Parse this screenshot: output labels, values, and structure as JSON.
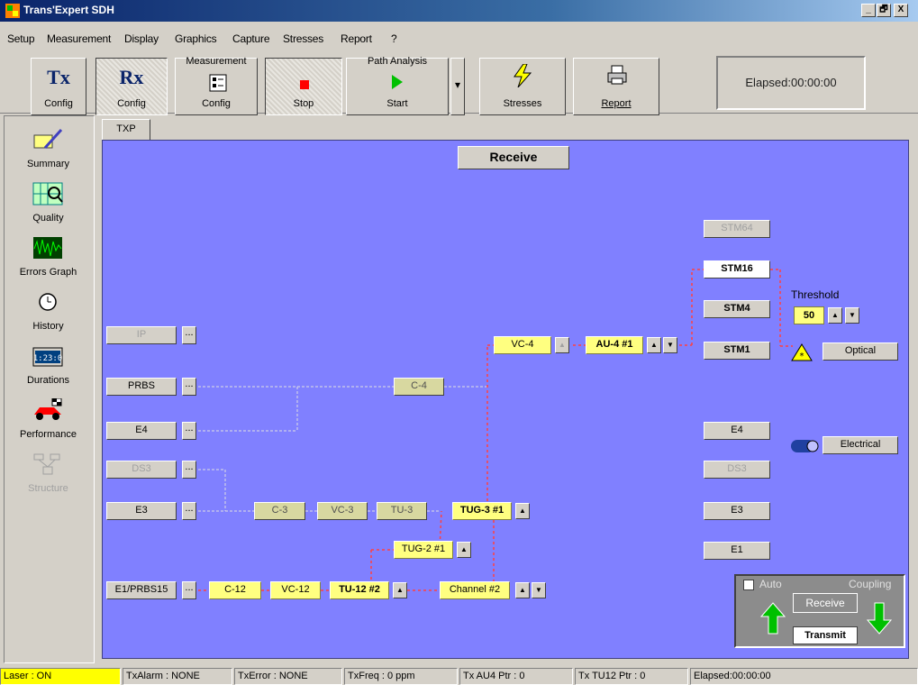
{
  "window": {
    "title": "Trans'Expert SDH",
    "min": "_",
    "max": "🗗",
    "close": "X"
  },
  "menu": [
    "Setup",
    "Measurement",
    "Display",
    "Graphics",
    "Capture",
    "Stresses",
    "Report",
    "?"
  ],
  "toolbar": {
    "tx": {
      "glyph": "Tx",
      "label": "Config"
    },
    "rx": {
      "glyph": "Rx",
      "label": "Config"
    },
    "measurement": {
      "top": "Measurement",
      "label": "Config"
    },
    "stop": {
      "label": "Stop"
    },
    "start": {
      "top": "Path Analysis",
      "label": "Start",
      "dropdown": "▾"
    },
    "stresses": {
      "label": "Stresses"
    },
    "report": {
      "label": "Report"
    },
    "elapsed": "Elapsed:00:00:00"
  },
  "sidebar": [
    {
      "name": "summary",
      "label": "Summary",
      "icon": "summary-icon",
      "enabled": true
    },
    {
      "name": "quality",
      "label": "Quality",
      "icon": "quality-icon",
      "enabled": true
    },
    {
      "name": "errors-graph",
      "label": "Errors Graph",
      "icon": "errors-graph-icon",
      "enabled": true
    },
    {
      "name": "history",
      "label": "History",
      "icon": "clock-icon",
      "enabled": true
    },
    {
      "name": "durations",
      "label": "Durations",
      "icon": "timer-icon",
      "enabled": true,
      "readout": "01:23:01"
    },
    {
      "name": "performance",
      "label": "Performance",
      "icon": "race-car-icon",
      "enabled": true
    },
    {
      "name": "structure",
      "label": "Structure",
      "icon": "structure-icon",
      "enabled": false
    }
  ],
  "tab": "TXP",
  "canvas": {
    "title": "Receive",
    "left_signals": [
      {
        "id": "ip",
        "label": "IP",
        "enabled": false
      },
      {
        "id": "prbs",
        "label": "PRBS",
        "enabled": true
      },
      {
        "id": "e4",
        "label": "E4",
        "enabled": true
      },
      {
        "id": "ds3",
        "label": "DS3",
        "enabled": false
      },
      {
        "id": "e3",
        "label": "E3",
        "enabled": true
      },
      {
        "id": "e1prbs",
        "label": "E1/PRBS15",
        "enabled": true
      }
    ],
    "ellipsis": "...",
    "c4": "C-4",
    "c3": "C-3",
    "vc3": "VC-3",
    "tu3": "TU-3",
    "vc4": "VC-4",
    "au4": "AU-4 #1",
    "tug3": "TUG-3 #1",
    "tug2": "TUG-2 #1",
    "c12": "C-12",
    "vc12": "VC-12",
    "tu12": "TU-12 #2",
    "channel": "Channel #2",
    "arrow_up": "▲",
    "arrow_down": "▼",
    "right_signals": [
      {
        "id": "stm64",
        "label": "STM64",
        "enabled": false
      },
      {
        "id": "stm16",
        "label": "STM16",
        "selected": true
      },
      {
        "id": "stm4",
        "label": "STM4",
        "enabled": true
      },
      {
        "id": "stm1",
        "label": "STM1",
        "enabled": true
      },
      {
        "id": "e4r",
        "label": "E4",
        "enabled": true
      },
      {
        "id": "ds3r",
        "label": "DS3",
        "enabled": false
      },
      {
        "id": "e3r",
        "label": "E3",
        "enabled": true
      },
      {
        "id": "e1r",
        "label": "E1",
        "enabled": true
      }
    ],
    "threshold_label": "Threshold",
    "threshold_value": "50",
    "optical": "Optical",
    "electrical": "Electrical",
    "coupling": {
      "auto": "Auto",
      "title": "Coupling",
      "receive": "Receive",
      "transmit": "Transmit"
    }
  },
  "status": [
    {
      "text": "Laser : ON",
      "highlight": true
    },
    {
      "text": "TxAlarm : NONE"
    },
    {
      "text": "TxError : NONE"
    },
    {
      "text": "TxFreq : 0 ppm"
    },
    {
      "text": "Tx AU4 Ptr : 0"
    },
    {
      "text": "Tx TU12 Ptr : 0"
    },
    {
      "text": "Elapsed:00:00:00"
    }
  ],
  "colors": {
    "canvas": "#8080ff",
    "active_box": "#ffff80",
    "laser_on": "#ffff00",
    "path_wire": "#ff4040"
  }
}
